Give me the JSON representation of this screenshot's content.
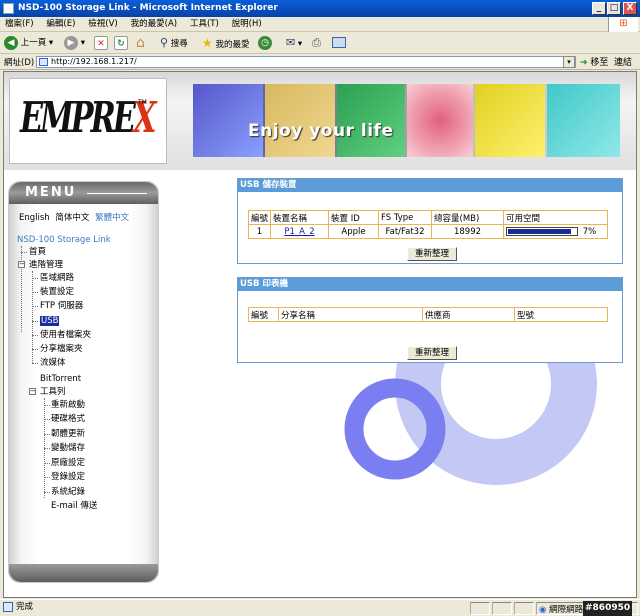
{
  "window": {
    "title": "NSD-100 Storage Link - Microsoft Internet Explorer",
    "minimize": "_",
    "maximize": "□",
    "close": "X"
  },
  "menubar": {
    "items": [
      "檔案(F)",
      "編輯(E)",
      "檢視(V)",
      "我的最愛(A)",
      "工具(T)",
      "說明(H)"
    ]
  },
  "toolbar": {
    "back": "上一頁",
    "search": "搜尋",
    "favorites": "我的最愛"
  },
  "address": {
    "label": "網址(D)",
    "url": "http://192.168.1.217/",
    "go": "移至",
    "links": "連結"
  },
  "header": {
    "logo": "EMPREX",
    "logo_tm": "TM",
    "banner_text": "Enjoy your life"
  },
  "sidebar": {
    "title": "MENU",
    "lang": [
      "English",
      "简体中文",
      "繁體中文"
    ],
    "root": "NSD-100 Storage Link",
    "home": "首頁",
    "advanced": "進階管理",
    "advanced_items": [
      "區域網路",
      "裝置設定",
      "FTP 伺服器",
      "USB",
      "使用者檔案夾",
      "分享檔案夾",
      "流媒体",
      "BitTorrent"
    ],
    "tools": "工具列",
    "tools_items": [
      "重新啟動",
      "硬碟格式",
      "韌體更新",
      "變動儲存",
      "原廠設定",
      "登錄設定",
      "系統紀錄",
      "E-mail 傳送"
    ]
  },
  "usb_storage": {
    "title": "USB 儲存裝置",
    "headers": [
      "編號",
      "裝置名稱",
      "裝置 ID",
      "FS Type",
      "總容量(MB)",
      "可用空間"
    ],
    "rows": [
      {
        "no": "1",
        "name": "P1_A_2",
        "id": "Apple",
        "fs": "Fat/Fat32",
        "total": "18992",
        "free_pct": "7%",
        "free_fraction": 0.93
      }
    ],
    "refresh": "重新整理"
  },
  "usb_printer": {
    "title": "USB 印表機",
    "headers": [
      "編號",
      "分享名稱",
      "供應商",
      "型號"
    ],
    "refresh": "重新整理"
  },
  "statusbar": {
    "status": "完成",
    "zone": "網際網路",
    "watermark": "#860950"
  }
}
